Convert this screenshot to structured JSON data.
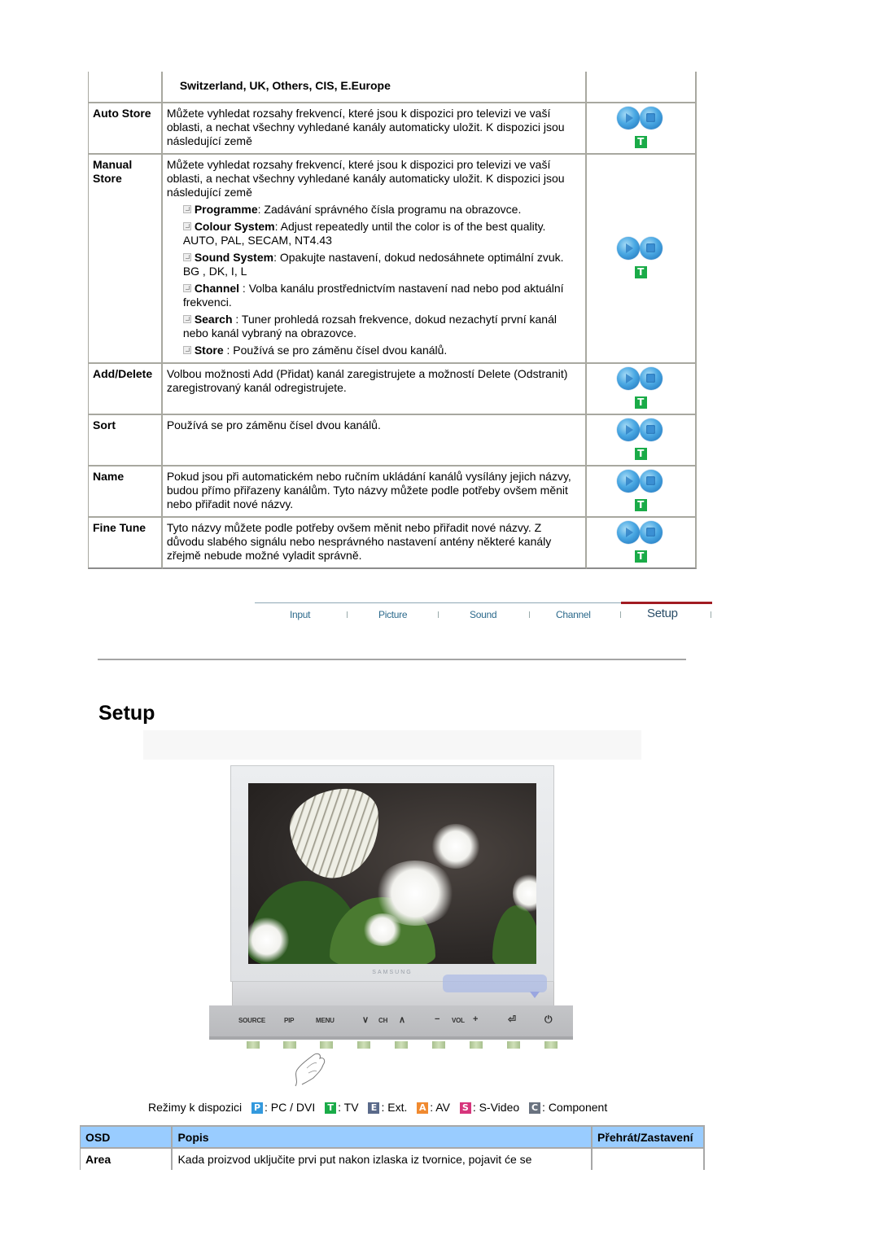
{
  "channel_table": {
    "header_note": "Switzerland, UK, Others, CIS, E.Europe",
    "rows": [
      {
        "osd": "Auto Store",
        "description": "Můžete vyhledat rozsahy frekvencí, které jsou k dispozici pro televizi ve vaší oblasti, a nechat všechny vyhledané kanály automaticky uložit. K dispozici jsou následující země",
        "mode_badge": "T"
      },
      {
        "osd": "Manual Store",
        "description": "Můžete vyhledat rozsahy frekvencí, které jsou k dispozici pro televizi ve vaší oblasti, a nechat všechny vyhledané kanály automaticky uložit. K dispozici jsou následující země",
        "sub_items": [
          {
            "term": "Programme",
            "text": ": Zadávání správného čísla programu na obrazovce.",
            "extra": ""
          },
          {
            "term": "Colour System",
            "text": ": Adjust repeatedly until the color is of the best quality.",
            "extra": "AUTO, PAL, SECAM, NT4.43"
          },
          {
            "term": "Sound System",
            "text": ": Opakujte nastavení, dokud nedosáhnete optimální zvuk.",
            "extra": "BG , DK, I, L"
          },
          {
            "term": "Channel",
            "text": " : Volba kanálu prostřednictvím nastavení nad nebo pod aktuální frekvenci.",
            "extra": ""
          },
          {
            "term": "Search",
            "text": " : Tuner prohledá rozsah frekvence, dokud nezachytí první kanál nebo kanál vybraný na obrazovce.",
            "extra": ""
          },
          {
            "term": "Store",
            "text": " : Používá se pro záměnu čísel dvou kanálů.",
            "extra": ""
          }
        ],
        "mode_badge": "T"
      },
      {
        "osd": "Add/Delete",
        "description": "Volbou možnosti Add (Přidat) kanál zaregistrujete a možností Delete (Odstranit) zaregistrovaný kanál odregistrujete.",
        "mode_badge": "T"
      },
      {
        "osd": "Sort",
        "description": "Používá se pro záměnu čísel dvou kanálů.",
        "mode_badge": "T"
      },
      {
        "osd": "Name",
        "description": "Pokud jsou při automatickém nebo ručním ukládání kanálů vysílány jejich názvy, budou přímo přiřazeny kanálům. Tyto názvy můžete podle potřeby ovšem měnit nebo přiřadit nové názvy.",
        "mode_badge": "T"
      },
      {
        "osd": "Fine Tune",
        "description": "Tyto názvy můžete podle potřeby ovšem měnit nebo přiřadit nové názvy. Z důvodu slabého signálu nebo nesprávného nastavení antény některé kanály zřejmě nebude možné vyladit správně.",
        "mode_badge": "T"
      }
    ]
  },
  "nav": {
    "items": [
      "Input",
      "Picture",
      "Sound",
      "Channel",
      "Setup"
    ],
    "active": "Setup",
    "active_color": "#a11b22"
  },
  "section": {
    "title": "Setup"
  },
  "illustration": {
    "brand": "SAMSUNG",
    "panel_labels": [
      "SOURCE",
      "PIP",
      "MENU",
      "∨",
      "CH",
      "∧",
      "−",
      "VOL",
      "+",
      "⏎",
      "⏻"
    ]
  },
  "modes": {
    "label": "Režimy k dispozici",
    "items": [
      {
        "badge": "P",
        "text": ": PC / DVI",
        "color": "#3399dd"
      },
      {
        "badge": "T",
        "text": ": TV",
        "color": "#1aab48"
      },
      {
        "badge": "E",
        "text": ": Ext.",
        "color": "#5a6a8a"
      },
      {
        "badge": "A",
        "text": ": AV",
        "color": "#f08a30"
      },
      {
        "badge": "S",
        "text": ": S-Video",
        "color": "#d6357c"
      },
      {
        "badge": "C",
        "text": ": Component",
        "color": "#6a7380"
      }
    ]
  },
  "setup_table": {
    "headers": [
      "OSD",
      "Popis",
      "Přehrát/Zastavení"
    ],
    "header_bg": "#99ccff",
    "rows": [
      {
        "osd": "Area",
        "description": "Kada proizvod uključite prvi put nakon izlaska iz tvornice, pojavit će se"
      }
    ]
  }
}
